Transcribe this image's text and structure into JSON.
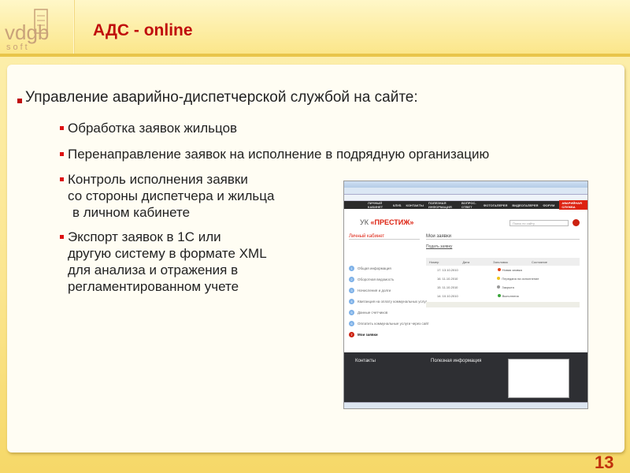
{
  "header": {
    "logo_text": "vdgb soft",
    "title": "АДС -  online"
  },
  "bullets": {
    "main": "Управление аварийно-диспетчерской службой на сайте:",
    "sub": [
      "Обработка заявок жильцов",
      "Перенаправление заявок на исполнение в подрядную организацию",
      [
        "Контроль исполнения заявки",
        "со стороны диспетчера и жильца",
        "в личном кабинете"
      ],
      [
        "Экспорт заявок в 1С или",
        "другую систему в формате XML",
        "для  анализа и отражения в",
        "регламентированном учете"
      ]
    ]
  },
  "screenshot": {
    "nav": [
      "ЛИЧНЫЙ КАБИНЕТ",
      "КЛУБ",
      "КОНТАКТЫ",
      "ПОЛЕЗНАЯ ИНФОРМАЦИЯ",
      "ВОПРОС-ОТВЕТ",
      "ФОТОГАЛЕРЕЯ",
      "ВИДЕОГАЛЕРЕЯ",
      "ФОРУМ",
      "АВАРИЙНАЯ СЛУЖБА"
    ],
    "brand_prefix": "УК ",
    "brand_name": "«ПРЕСТИЖ»",
    "search_placeholder": "Поиск по сайту",
    "left_title": "Личный кабинет",
    "right_title": "Мои заявки",
    "submit_link": "Подать заявку",
    "menu": [
      {
        "n": "1",
        "label": "Общая информация"
      },
      {
        "n": "2",
        "label": "Оборотная ведомость"
      },
      {
        "n": "3",
        "label": "Начисления и долги"
      },
      {
        "n": "4",
        "label": "Квитанция на оплату коммунальных услуг"
      },
      {
        "n": "5",
        "label": "Данные счетчиков"
      },
      {
        "n": "6",
        "label": "Оплатить коммунальные услуги через сайт"
      },
      {
        "n": "7",
        "label": "Мои заявки"
      }
    ],
    "table_headers": [
      "Номер",
      "Дата",
      "Заголовок",
      "Состояние"
    ],
    "rows": [
      {
        "num": "17. 13.10.2010",
        "status": "Новая заявка",
        "color": "#e5451c"
      },
      {
        "num": "16. 11.10.2010",
        "status": "Передана на исполнение",
        "color": "#f0c419"
      },
      {
        "num": "15. 11.10.2010",
        "status": "Закрыта",
        "color": "#999999"
      },
      {
        "num": "14. 10.10.2010",
        "status": "Выполнена",
        "color": "#3aa53a"
      }
    ],
    "footer": {
      "contacts": "Контакты",
      "useful": "Полезная информация"
    }
  },
  "page_number": "13",
  "colors": {
    "accent": "#c00d0d"
  }
}
